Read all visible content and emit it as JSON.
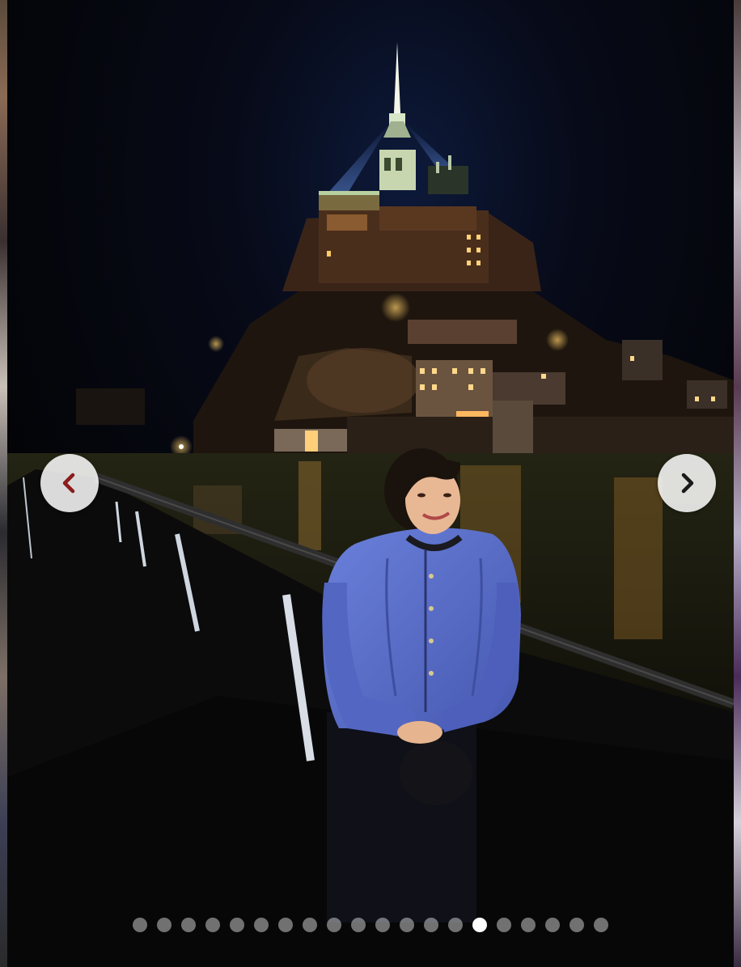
{
  "carousel": {
    "prev_icon": "chevron-left-icon",
    "next_icon": "chevron-right-icon",
    "prev_color": "#8b1c1c",
    "next_color": "#1a1a1a",
    "slide_count": 20,
    "active_index": 14
  },
  "colors": {
    "dot_inactive": "#c8c8c8",
    "dot_active": "#ffffff",
    "sweater": "#5a6ec8"
  }
}
